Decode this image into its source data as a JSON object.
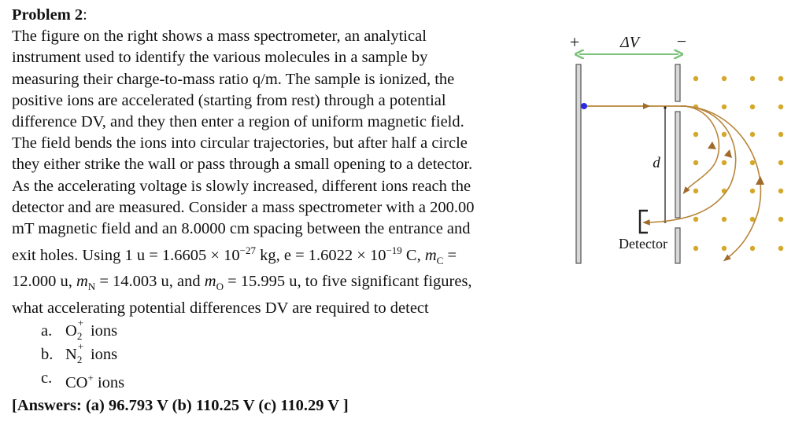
{
  "problem": {
    "title": "Problem 2",
    "title_suffix": ":",
    "lines": [
      "The figure on the right shows a mass spectrometer, an analytical",
      "instrument used to identify the various molecules in a sample by",
      "measuring their charge-to-mass ratio q/m. The sample is ionized, the",
      "positive ions are accelerated (starting from rest) through a potential",
      "difference DV, and they then enter a region of uniform magnetic field.",
      "The field bends the ions into circular trajectories, but after half a circle",
      "they either strike the wall or pass through a small opening to a detector.",
      "As the accelerating voltage is slowly increased, different ions reach the",
      "detector and are measured. Consider a mass spectrometer with a 200.00",
      "mT magnetic field and an 8.0000 cm spacing between the entrance and"
    ],
    "line11": {
      "a": "exit holes. Using 1 u = 1.6605 × 10",
      "exp1": "−27",
      "b": " kg, e = 1.6022 × 10",
      "exp2": "−19",
      "c": " C, ",
      "m": "m",
      "mC_sub": "C",
      "d": " ="
    },
    "line12": {
      "a": "12.000 u, ",
      "m1": "m",
      "mN_sub": "N",
      "b": " = 14.003 u, and ",
      "m2": "m",
      "mO_sub": "O",
      "c": " = 15.995 u, to five significant figures,"
    },
    "line13": "what accelerating potential differences DV are required to detect",
    "items": [
      {
        "marker": "a.",
        "species": "O",
        "sub": "2",
        "sup": "+",
        "suffix": " ions"
      },
      {
        "marker": "b.",
        "species": "N",
        "sub": "2",
        "sup": "+",
        "suffix": " ions"
      },
      {
        "marker": "c.",
        "species": "CO",
        "sub": "",
        "sup": "+",
        "suffix": " ions"
      }
    ],
    "answers": "[Answers: (a) 96.793 V (b) 110.25 V (c) 110.29 V ]"
  },
  "figure": {
    "plus_label": "+",
    "minus_label": "−",
    "delta_v_label": "ΔV",
    "d_label": "d",
    "detector_label": "Detector",
    "colors": {
      "arrow_green": "#7cc27a",
      "beam": "#b8863a",
      "field_dot": "#d4a82a",
      "source_dot": "#2a2ae0",
      "plate_fill": "#d8d8d8",
      "plate_stroke": "#555555"
    },
    "field_direction": "out of page"
  }
}
